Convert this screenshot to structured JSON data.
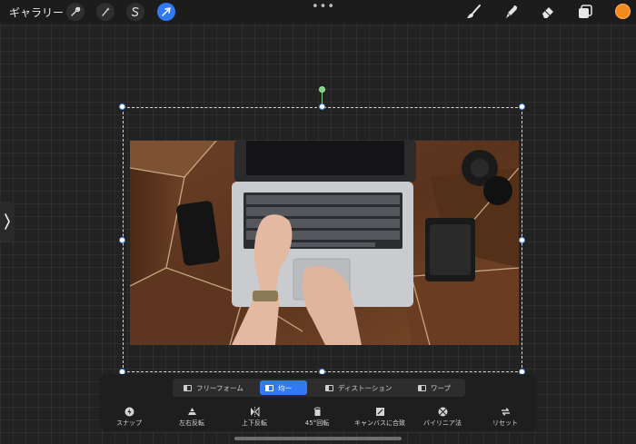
{
  "topbar": {
    "gallery_label": "ギャラリー",
    "tools": [
      {
        "name": "wrench-icon"
      },
      {
        "name": "magic-wand-icon"
      },
      {
        "name": "selection-s-icon"
      },
      {
        "name": "transform-arrow-icon",
        "active": true
      }
    ],
    "right_tools": [
      "brush-icon",
      "smudge-icon",
      "eraser-icon",
      "layers-icon"
    ],
    "more_label": "•••",
    "color": "#f28a1e"
  },
  "canvas": {
    "image_alt": "",
    "selection_color": "#4b8ef5"
  },
  "panel": {
    "modes": [
      {
        "label": "フリーフォーム"
      },
      {
        "label": "均一",
        "active": true
      },
      {
        "label": "ディストーション"
      },
      {
        "label": "ワープ"
      }
    ],
    "actions": [
      {
        "label": "スナップ",
        "icon": "snap-icon"
      },
      {
        "label": "左右反転",
        "icon": "flip-horizontal-icon"
      },
      {
        "label": "上下反転",
        "icon": "flip-vertical-icon"
      },
      {
        "label": "45°回転",
        "icon": "rotate-45-icon"
      },
      {
        "label": "キャンバスに合致",
        "icon": "fit-canvas-icon"
      },
      {
        "label": "バイリニア法",
        "icon": "bilinear-icon"
      },
      {
        "label": "リセット",
        "icon": "reset-icon"
      }
    ]
  },
  "accent": "#2f7bf5"
}
